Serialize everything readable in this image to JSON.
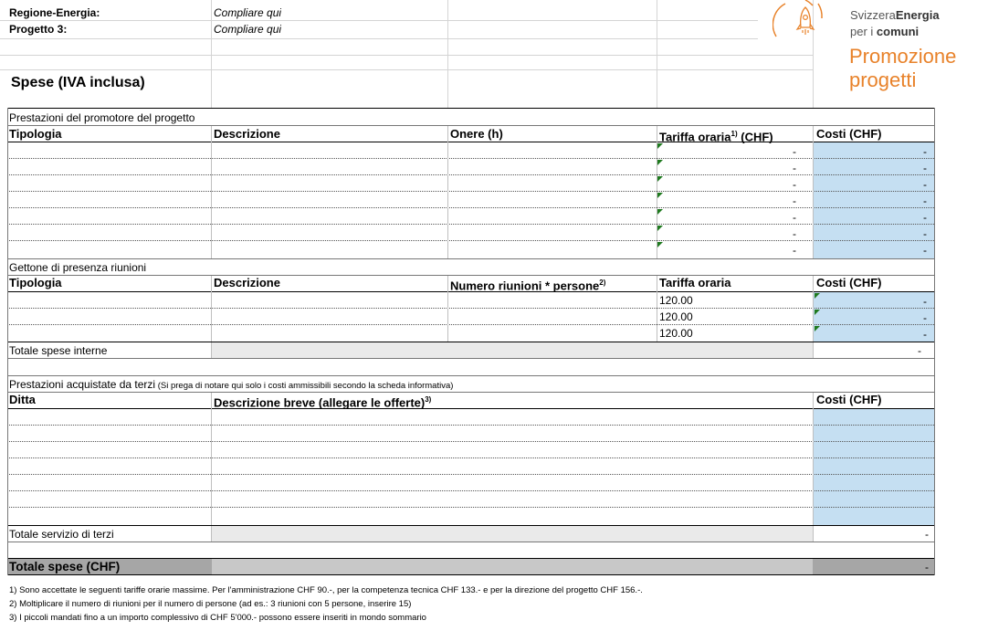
{
  "header": {
    "region_label": "Regione-Energia:",
    "region_value": "Compliare qui",
    "project_label": "Progetto 3:",
    "project_value": "Compliare qui",
    "title": "Spese (IVA inclusa)"
  },
  "logo": {
    "brand_part1": "Svizzera",
    "brand_part2": "Energia",
    "sub_part1": "per i ",
    "sub_part2": "comuni",
    "promo_line1": "Promozione",
    "promo_line2": "progetti",
    "accent_color": "#e8822a"
  },
  "section1": {
    "title": "Prestazioni del promotore del progetto",
    "col_tipologia": "Tipologia",
    "col_descrizione": "Descrizione",
    "col_onere": "Onere (h)",
    "col_tariffa": "Tariffa oraria",
    "col_tariffa_sup": "1)",
    "col_tariffa_unit": " (CHF)",
    "col_costi": "Costi (CHF)",
    "row_value": "-"
  },
  "section2": {
    "title": "Gettone di presenza riunioni",
    "col_tipologia": "Tipologia",
    "col_descrizione": "Descrizione",
    "col_numero": "Numero riunioni * persone",
    "col_numero_sup": "2)",
    "col_tariffa": "Tariffa oraria",
    "col_costi": "Costi (CHF)",
    "rates": [
      "120.00",
      "120.00",
      "120.00"
    ],
    "row_value": "-",
    "total_label": "Totale spese interne",
    "total_value": "-"
  },
  "section3": {
    "title": "Prestazioni acquistate da terzi",
    "note": " (Si prega di notare qui solo i costi ammissibili secondo la scheda informativa)",
    "col_ditta": "Ditta",
    "col_descr": "Descrizione breve (allegare le offerte)",
    "col_descr_sup": "3)",
    "col_costi": "Costi (CHF)",
    "total_label": "Totale servizio di terzi",
    "total_value": "-"
  },
  "grand_total": {
    "label": "Totale spese (CHF)",
    "value": "-"
  },
  "footnotes": [
    "1) Sono accettate le seguenti tariffe orarie massime. Per l'amministrazione CHF 90.-, per la competenza tecnica CHF 133.- e per la direzione del progetto CHF 156.-.",
    "2) Moltiplicare il numero di riunioni per il numero di persone (ad es.: 3 riunioni con 5 persone, inserire 15)",
    "3) I piccoli mandati fino a un importo complessivo di CHF 5'000.- possono essere inseriti in mondo sommario"
  ]
}
